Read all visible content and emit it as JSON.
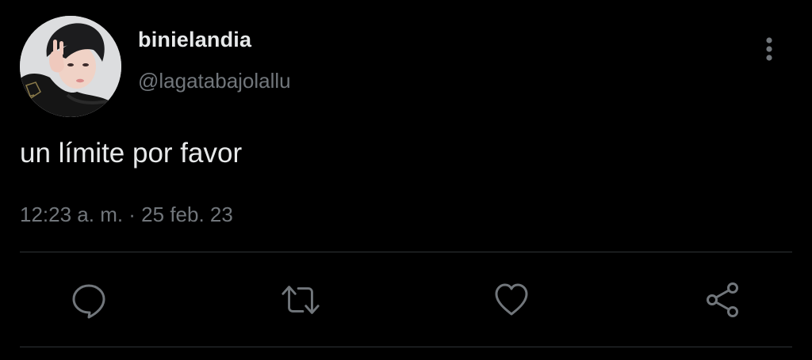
{
  "tweet": {
    "display_name": "binielandia",
    "handle": "@lagatabajolallu",
    "text": "un límite por favor",
    "timestamp": "12:23 a. m. · 25 feb. 23"
  },
  "icons": {
    "more": "more-vertical-icon",
    "reply": "reply-icon",
    "retweet": "retweet-icon",
    "like": "heart-icon",
    "share": "share-icon"
  },
  "colors": {
    "background": "#000000",
    "primary_text": "#e7e9ea",
    "secondary_text": "#71767b",
    "divider": "#2f3336",
    "icon": "#71767b"
  }
}
